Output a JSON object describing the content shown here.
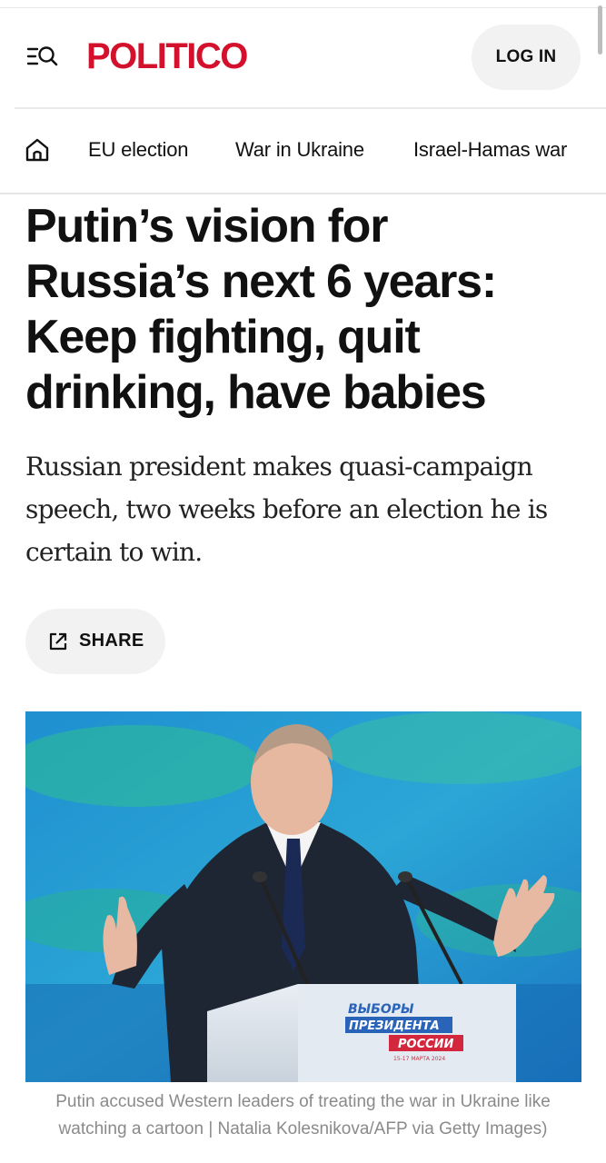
{
  "header": {
    "logo": "POLITICO",
    "login_label": "LOG IN"
  },
  "nav": {
    "items": [
      {
        "label": "EU election"
      },
      {
        "label": "War in Ukraine"
      },
      {
        "label": "Israel-Hamas war"
      }
    ]
  },
  "article": {
    "headline_lines": [
      "Putin’s vision for",
      "Russia’s next 6 years:",
      "Keep fighting, quit",
      "drinking, have babies"
    ],
    "dek_lines": [
      "Russian president makes quasi-campaign",
      "speech, two weeks before an election he is",
      "certain to win."
    ],
    "share_label": "SHARE",
    "image": {
      "podium_lines": [
        "ВЫБОРЫ",
        "ПРЕЗИДЕНТА",
        "РОССИИ",
        "15-17 МАРТА 2024"
      ]
    },
    "caption_lines": [
      "Putin accused Western leaders of treating the war in Ukraine like",
      "watching a cartoon | Natalia Kolesnikova/AFP via Getty Images)"
    ]
  },
  "colors": {
    "brand": "#d4112c",
    "button_bg": "#f2f2f2",
    "caption": "#8a8a8a"
  },
  "icons": {
    "menu": "menu-search-icon",
    "home": "home-icon",
    "share": "external-link-icon"
  }
}
